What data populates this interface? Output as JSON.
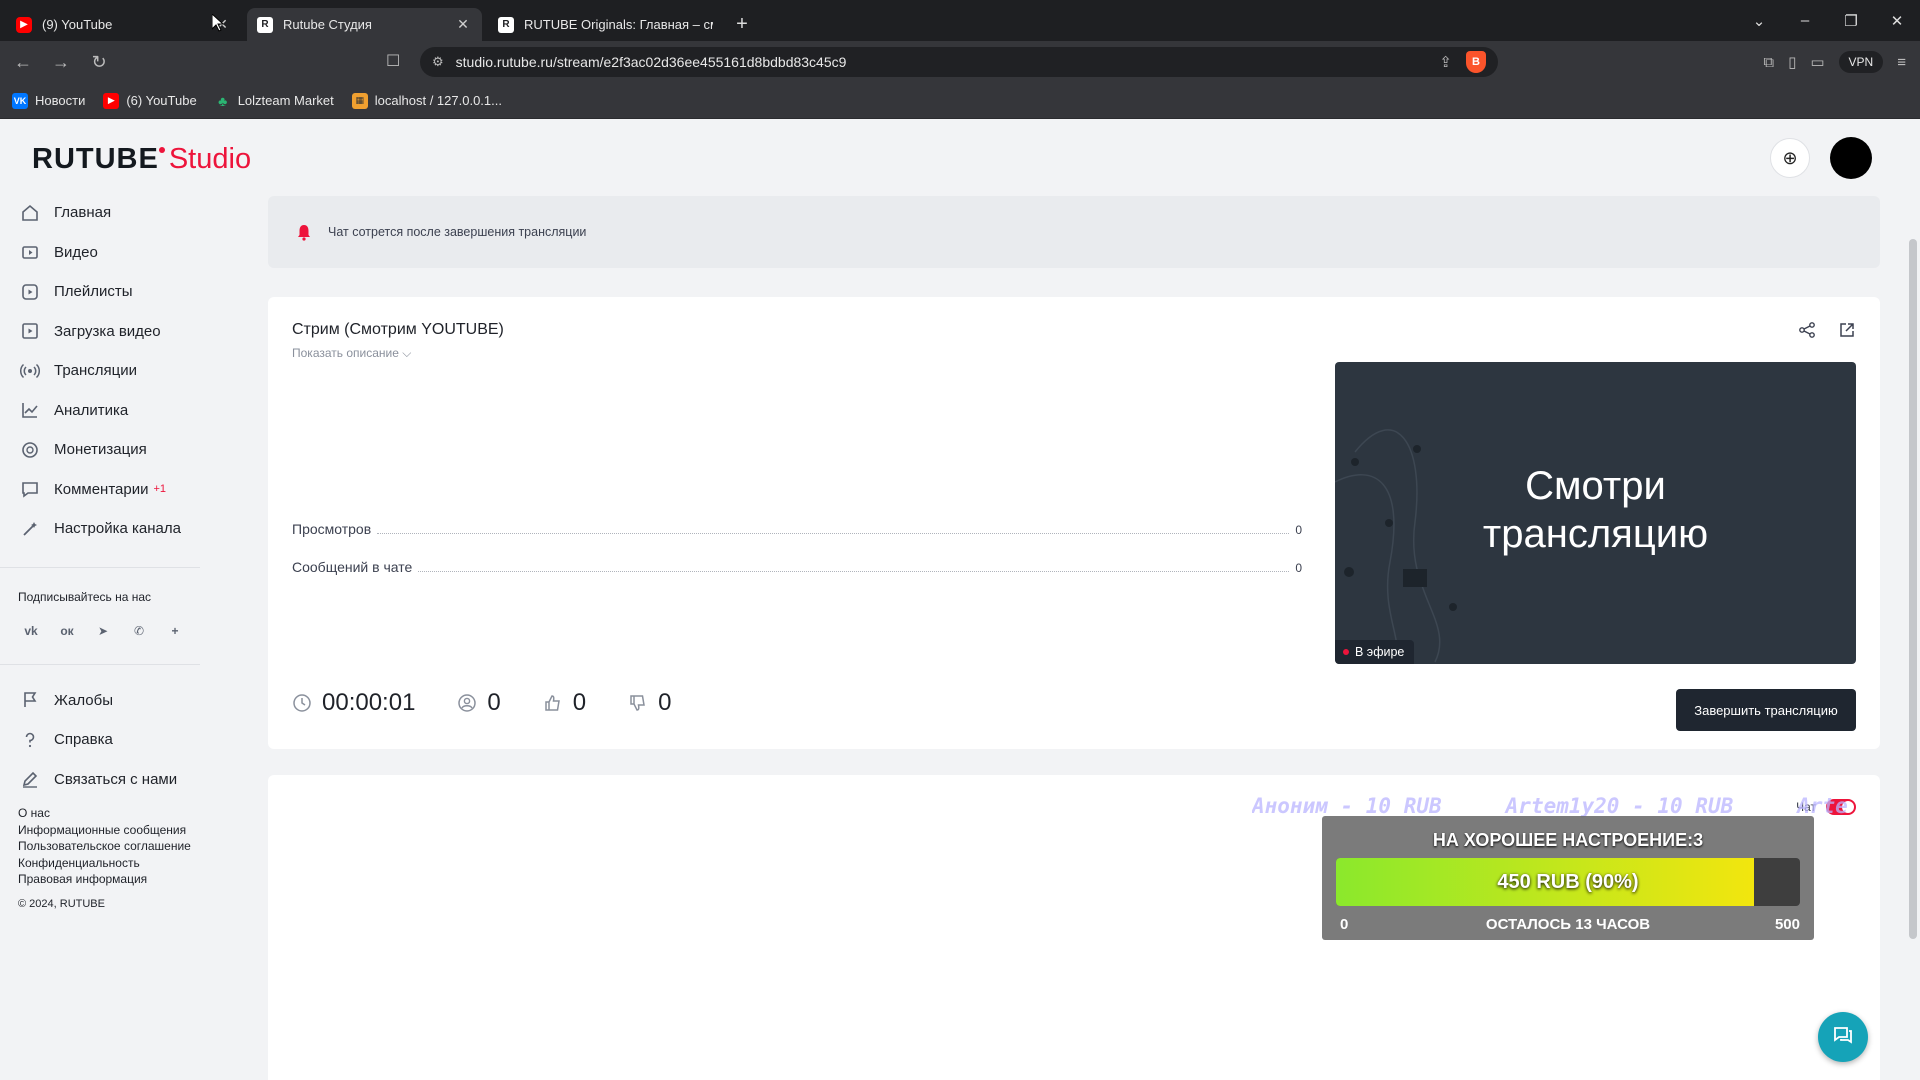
{
  "browser": {
    "tabs": [
      {
        "label": "(9) YouTube",
        "icon": "youtube-icon"
      },
      {
        "label": "Rutube Студия",
        "icon": "rutube-icon"
      },
      {
        "label": "RUTUBE Originals: Главная – смотр",
        "icon": "rutube-icon"
      }
    ],
    "url": "studio.rutube.ru/stream/e2f3ac02d36ee455161d8bdbd83c45c9",
    "vpn_label": "VPN",
    "bookmarks": [
      {
        "label": "Новости",
        "icon": "vk-icon"
      },
      {
        "label": "(6) YouTube",
        "icon": "youtube-icon"
      },
      {
        "label": "Lolzteam Market",
        "icon": "lolzteam-icon"
      },
      {
        "label": "localhost / 127.0.0.1...",
        "icon": "phpmyadmin-icon"
      }
    ]
  },
  "brand": {
    "part1": "RUTUBE",
    "part2": "Studio",
    "accent": "#ed143b"
  },
  "sidebar": {
    "items": [
      {
        "label": "Главная",
        "icon": "home-icon"
      },
      {
        "label": "Видео",
        "icon": "video-icon"
      },
      {
        "label": "Плейлисты",
        "icon": "playlist-icon"
      },
      {
        "label": "Загрузка видео",
        "icon": "upload-icon"
      },
      {
        "label": "Трансляции",
        "icon": "broadcast-icon"
      },
      {
        "label": "Аналитика",
        "icon": "analytics-icon"
      },
      {
        "label": "Монетизация",
        "icon": "monetization-icon"
      },
      {
        "label": "Комментарии",
        "icon": "comments-icon",
        "badge": "+1"
      },
      {
        "label": "Настройка канала",
        "icon": "wand-icon"
      }
    ],
    "follow_label": "Подписывайтесь на нас",
    "socials": [
      "vk-icon",
      "odnoklassniki-icon",
      "telegram-icon",
      "viber-icon",
      "more-icon"
    ],
    "bottom_items": [
      {
        "label": "Жалобы",
        "icon": "flag-icon"
      },
      {
        "label": "Справка",
        "icon": "help-icon"
      },
      {
        "label": "Связаться с нами",
        "icon": "pen-icon"
      }
    ],
    "links": [
      "О нас",
      "Информационные сообщения",
      "Пользовательское соглашение",
      "Конфиденциальность",
      "Правовая информация"
    ],
    "copyright": "© 2024, RUTUBE"
  },
  "notice": {
    "text": "Чат сотрется после завершения трансляции"
  },
  "stream": {
    "title": "Стрим (Смотрим YOUTUBE)",
    "show_description": "Показать описание",
    "stats": [
      {
        "label": "Просмотров",
        "value": "0"
      },
      {
        "label": "Сообщений в чате",
        "value": "0"
      }
    ],
    "preview_text_line1": "Смотри",
    "preview_text_line2": "трансляцию",
    "live_label": "В эфире",
    "duration": "00:00:01",
    "viewers": "0",
    "likes": "0",
    "dislikes": "0",
    "end_button": "Завершить трансляцию"
  },
  "chat": {
    "label": "Чат",
    "enabled": true
  },
  "donation": {
    "ticker": [
      "Аноним - 10 RUB",
      "Artem1y20 - 10 RUB",
      "Arte"
    ],
    "title": "НА ХОРОШЕЕ НАСТРОЕНИЕ:3",
    "progress_text": "450 RUB (90%)",
    "progress_fraction": 0.9,
    "min": "0",
    "max": "500",
    "remaining": "ОСТАЛОСЬ 13 ЧАСОВ"
  }
}
